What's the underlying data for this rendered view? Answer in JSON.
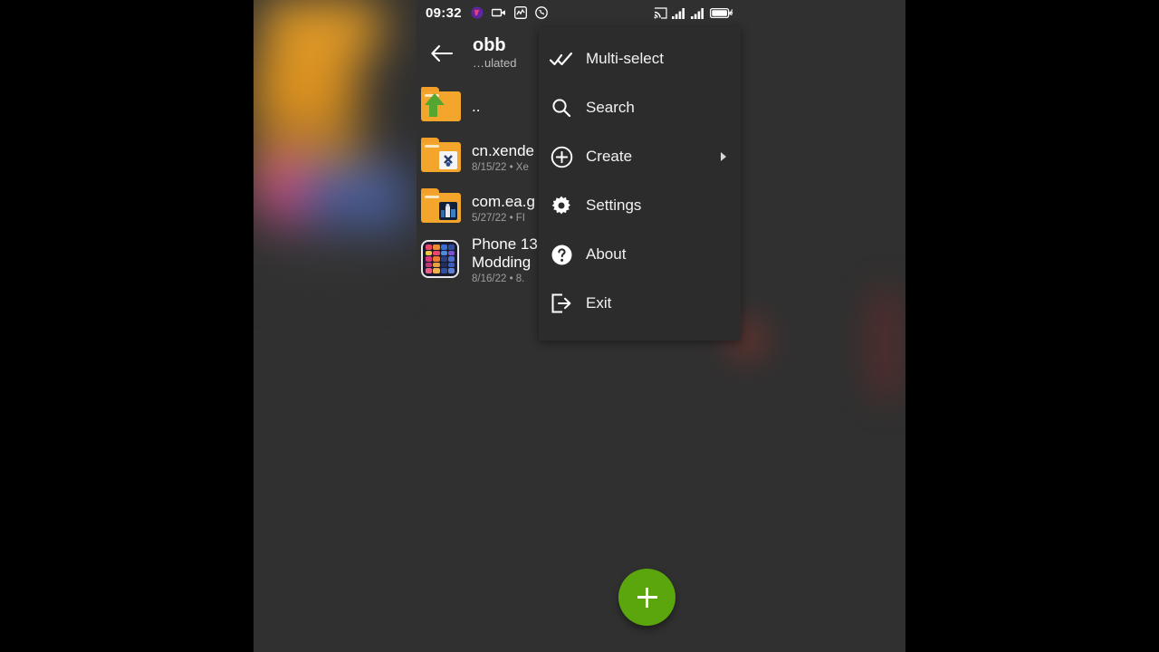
{
  "status_bar": {
    "time": "09:32",
    "left_icons": [
      "phonepe-icon",
      "video-camera-icon",
      "activity-chart-icon",
      "whatsapp-icon"
    ],
    "right_icons": [
      "cast-icon",
      "signal-bars-sim1-icon",
      "signal-bars-sim2-icon",
      "battery-charging-icon"
    ]
  },
  "app_bar": {
    "back_icon": "back-arrow-icon",
    "title": "obb",
    "subtitle": "…ulated"
  },
  "file_list": {
    "items": [
      {
        "name": "..",
        "sub": "",
        "icon": "folder-up-icon"
      },
      {
        "name": "cn.xende",
        "sub": "8/15/22  •   Xe",
        "icon": "folder-icon"
      },
      {
        "name": "com.ea.g",
        "sub": "5/27/22  •   FI",
        "icon": "folder-icon"
      },
      {
        "name": "Phone 13 Modding",
        "sub": "8/16/22  •   8.",
        "icon": "image-thumbnail-icon"
      }
    ]
  },
  "menu": {
    "items": [
      {
        "label": "Multi-select",
        "icon": "double-check-icon",
        "has_submenu": false
      },
      {
        "label": "Search",
        "icon": "search-icon",
        "has_submenu": false
      },
      {
        "label": "Create",
        "icon": "plus-circle-icon",
        "has_submenu": true
      },
      {
        "label": "Settings",
        "icon": "gear-icon",
        "has_submenu": false
      },
      {
        "label": "About",
        "icon": "question-circle-icon",
        "has_submenu": false
      },
      {
        "label": "Exit",
        "icon": "exit-icon",
        "has_submenu": false
      }
    ]
  },
  "fab": {
    "icon": "plus-icon",
    "color": "#5aa60c"
  },
  "colors": {
    "background": "#303030",
    "menu_background": "#2c2c2c",
    "folder": "#f4a62c",
    "accent_green": "#5aa60c",
    "text_primary": "#ffffff",
    "text_secondary": "#9e9e9e"
  }
}
